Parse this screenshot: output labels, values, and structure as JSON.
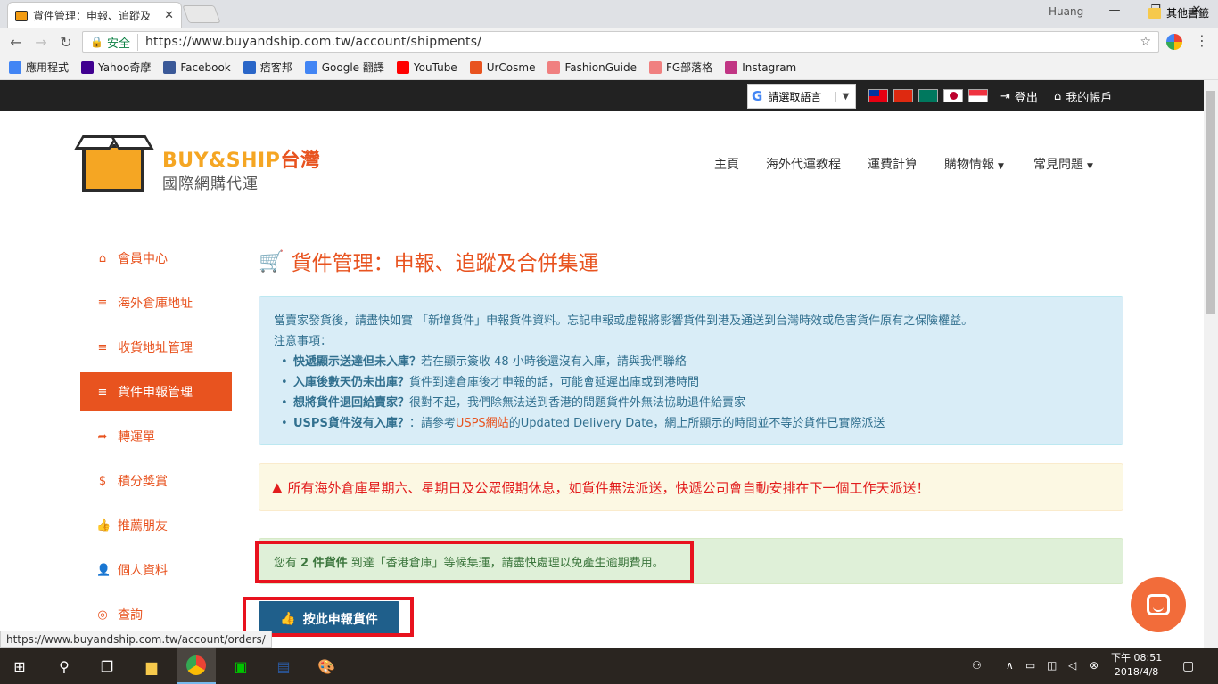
{
  "browser": {
    "tab_title": "貨件管理：申報、追蹤及",
    "user": "Huang",
    "secure_label": "安全",
    "url": "https://www.buyandship.com.tw/account/shipments/",
    "status_url": "https://www.buyandship.com.tw/account/orders/"
  },
  "bookmarks": [
    {
      "label": "應用程式",
      "icon": "apps-grid-icon",
      "color": "#4285f4"
    },
    {
      "label": "Yahoo奇摩",
      "icon": "yahoo-icon",
      "color": "#400090"
    },
    {
      "label": "Facebook",
      "icon": "facebook-icon",
      "color": "#3b5998"
    },
    {
      "label": "痞客邦",
      "icon": "pixnet-icon",
      "color": "#2a66c8"
    },
    {
      "label": "Google 翻譯",
      "icon": "google-translate-icon",
      "color": "#4285f4"
    },
    {
      "label": "YouTube",
      "icon": "youtube-icon",
      "color": "#ff0000"
    },
    {
      "label": "UrCosme",
      "icon": "urcosme-icon",
      "color": "#e8531f"
    },
    {
      "label": "FashionGuide",
      "icon": "fashionguide-icon",
      "color": "#f08080"
    },
    {
      "label": "FG部落格",
      "icon": "fg-blog-icon",
      "color": "#f08080"
    },
    {
      "label": "Instagram",
      "icon": "instagram-icon",
      "color": "#c13584"
    }
  ],
  "bookmarks_other": "其他書籤",
  "topbar": {
    "language_placeholder": "請選取語言",
    "logout": "登出",
    "account": "我的帳戶"
  },
  "logo": {
    "buy": "BUY",
    "amp": "&",
    "ship": "SHIP",
    "region": "台灣",
    "tagline": "國際網購代運"
  },
  "nav": {
    "home": "主頁",
    "tutorial": "海外代運教程",
    "shipping_calc": "運費計算",
    "shopping_info": "購物情報",
    "faq": "常見問題"
  },
  "sidebar": [
    {
      "label": "會員中心",
      "icon": "home-icon",
      "glyph": "⌂"
    },
    {
      "label": "海外倉庫地址",
      "icon": "list-icon",
      "glyph": "≡"
    },
    {
      "label": "收貨地址管理",
      "icon": "list-icon",
      "glyph": "≡"
    },
    {
      "label": "貨件申報管理",
      "icon": "list-icon",
      "glyph": "≡"
    },
    {
      "label": "轉運單",
      "icon": "share-arrow-icon",
      "glyph": "➦"
    },
    {
      "label": "積分獎賞",
      "icon": "dollar-icon",
      "glyph": "$"
    },
    {
      "label": "推薦朋友",
      "icon": "thumbs-up-icon",
      "glyph": "👍"
    },
    {
      "label": "個人資料",
      "icon": "user-icon",
      "glyph": "👤"
    },
    {
      "label": "查詢",
      "icon": "lifebuoy-icon",
      "glyph": "◎"
    }
  ],
  "page_title": "貨件管理：申報、追蹤及合併集運",
  "info": {
    "intro": "當賣家發貨後，請盡快如實 「新增貨件」申報貨件資料。忘記申報或虛報將影響貨件到港及通送到台灣時效或危害貨件原有之保險權益。",
    "notes_title": "注意事項：",
    "items": [
      {
        "bold": "快遞顯示送達但未入庫？",
        "text": "若在顯示簽收 48 小時後還沒有入庫，請與我們聯絡"
      },
      {
        "bold": "入庫後數天仍未出庫？",
        "text": "貨件到達倉庫後才申報的話，可能會延遲出庫或到港時間"
      },
      {
        "bold": "想將貨件退回給賣家？",
        "text": "很對不起，我們除無法送到香港的問題貨件外無法協助退件給賣家"
      }
    ],
    "usps_bold": "USPS貨件沒有入庫？",
    "usps_pre": "：請參考",
    "usps_link": "USPS網站",
    "usps_post": "的Updated Delivery Date，網上所顯示的時間並不等於貨件已實際派送"
  },
  "warning": "所有海外倉庫星期六、星期日及公眾假期休息，如貨件無法派送，快遞公司會自動安排在下一個工作天派送！",
  "success": {
    "pre": "您有",
    "count": "2 件貨件",
    "post": "到達「香港倉庫」等候集運，請盡快處理以免產生逾期費用。"
  },
  "declare_button": "按此申報貨件",
  "taskbar": {
    "time": "下午 08:51",
    "date": "2018/4/8"
  },
  "colors": {
    "brand_orange": "#e8531f",
    "logo_yellow": "#f5a623",
    "button_blue": "#1f5f8b",
    "highlight_red": "#e8121e"
  }
}
